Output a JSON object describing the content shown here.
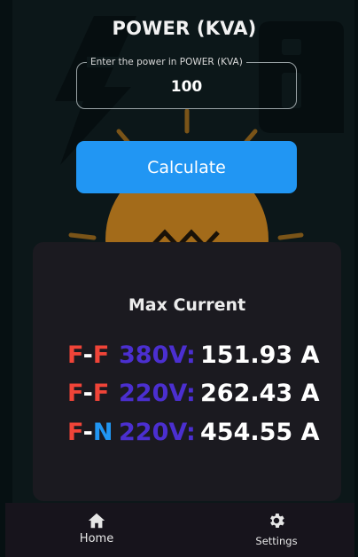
{
  "header": {
    "title": "POWER (KVA)"
  },
  "input": {
    "label": "Enter the power in POWER (KVA)",
    "value": "100"
  },
  "actions": {
    "calculate_label": "Calculate"
  },
  "result": {
    "title": "Max Current",
    "rows": [
      {
        "phase_a": "F",
        "sep": "-",
        "phase_b": "F",
        "voltage": "380V:",
        "current": "151.93 A"
      },
      {
        "phase_a": "F",
        "sep": "-",
        "phase_b": "F",
        "voltage": "220V:",
        "current": "262.43 A"
      },
      {
        "phase_a": "F",
        "sep": "-",
        "phase_b": "N",
        "voltage": "220V:",
        "current": "454.55 A"
      }
    ]
  },
  "nav": {
    "items": [
      {
        "label": "Home",
        "icon": "home-icon"
      },
      {
        "label": "Settings",
        "icon": "gear-icon"
      }
    ]
  },
  "colors": {
    "accent": "#2196f3",
    "phase_red": "#f04438",
    "voltage_purple": "#4b2fd0",
    "card_bg": "#1b1a20"
  }
}
